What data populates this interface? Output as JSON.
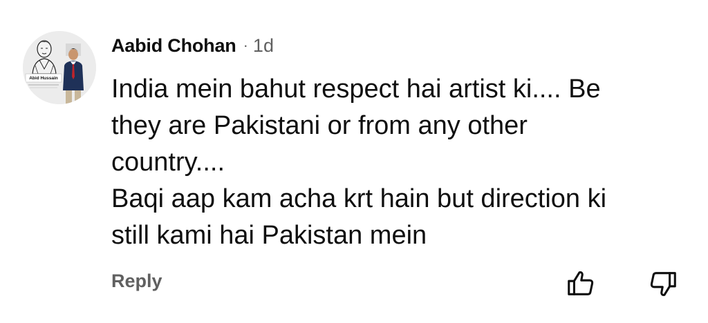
{
  "comment": {
    "author": "Aabid Chohan",
    "separator": "·",
    "time": "1d",
    "avatar": {
      "caption": "Abid Hussain",
      "background": "#eeeeee"
    },
    "text_lines": [
      "India mein bahut respect hai artist ki.... Be",
      "they are Pakistani or from any other",
      "country....",
      "Baqi aap kam acha krt hain but direction ki",
      "still kami hai Pakistan mein"
    ],
    "actions": {
      "reply_label": "Reply",
      "like_icon": "thumbs-up-icon",
      "dislike_icon": "thumbs-down-icon"
    }
  },
  "colors": {
    "text_primary": "#0f0f0f",
    "text_secondary": "#606060",
    "background": "#ffffff"
  }
}
